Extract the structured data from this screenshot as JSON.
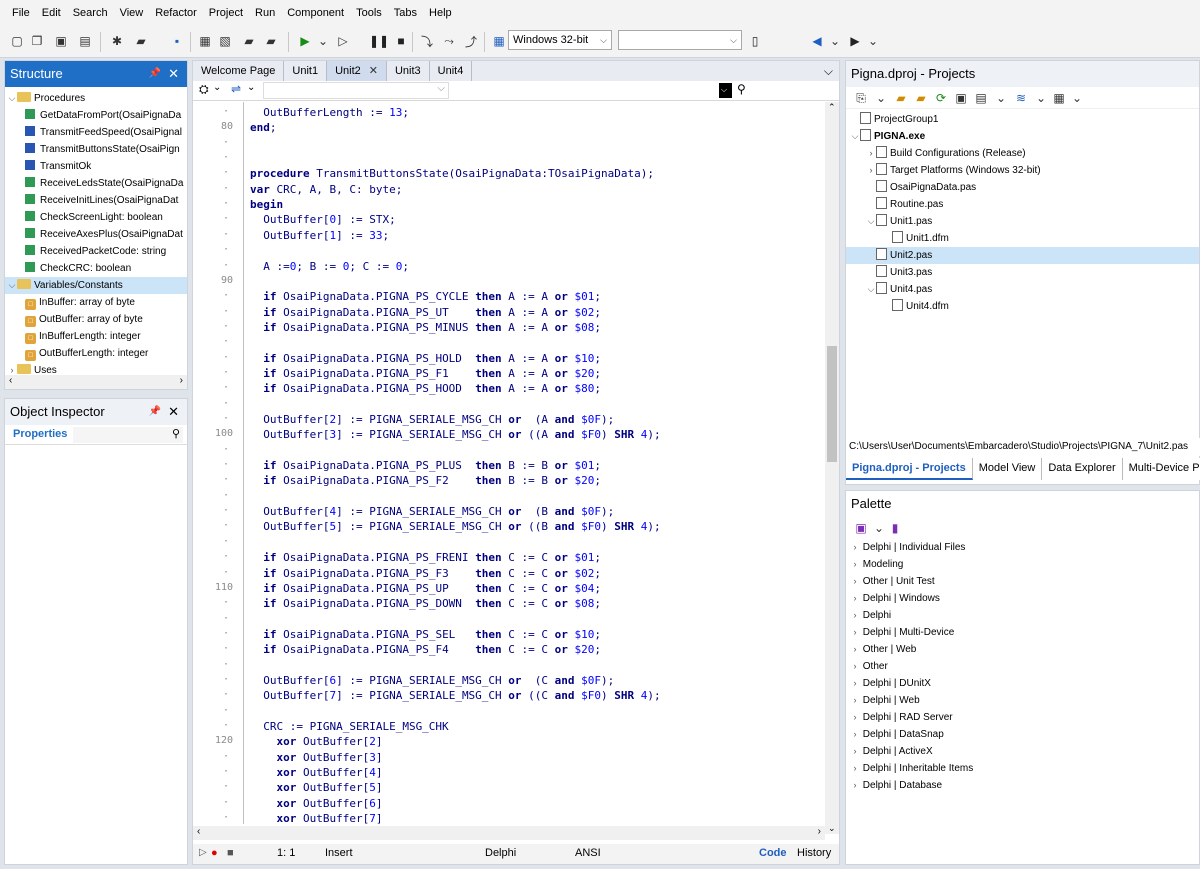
{
  "menu": [
    "File",
    "Edit",
    "Search",
    "View",
    "Refactor",
    "Project",
    "Run",
    "Component",
    "Tools",
    "Tabs",
    "Help"
  ],
  "toolbar": {
    "platform": "Windows 32-bit",
    "config": ""
  },
  "structure": {
    "title": "Structure",
    "items": [
      {
        "label": "Procedures",
        "kind": "folder",
        "level": 0,
        "expanded": true
      },
      {
        "label": "GetDataFromPort(OsaiPignaDa",
        "kind": "proc-green",
        "level": 1
      },
      {
        "label": "TransmitFeedSpeed(OsaiPignal",
        "kind": "proc-blue",
        "level": 1
      },
      {
        "label": "TransmitButtonsState(OsaiPign",
        "kind": "proc-blue",
        "level": 1
      },
      {
        "label": "TransmitOk",
        "kind": "proc-blue",
        "level": 1
      },
      {
        "label": "ReceiveLedsState(OsaiPignaDa",
        "kind": "proc-green",
        "level": 1
      },
      {
        "label": "ReceiveInitLines(OsaiPignaDat",
        "kind": "proc-green",
        "level": 1
      },
      {
        "label": "CheckScreenLight: boolean",
        "kind": "proc-green",
        "level": 1
      },
      {
        "label": "ReceiveAxesPlus(OsaiPignaDat",
        "kind": "proc-green",
        "level": 1
      },
      {
        "label": "ReceivedPacketCode: string",
        "kind": "proc-green",
        "level": 1
      },
      {
        "label": "CheckCRC: boolean",
        "kind": "proc-green",
        "level": 1
      },
      {
        "label": "Variables/Constants",
        "kind": "folder",
        "level": 0,
        "expanded": true,
        "selected": true
      },
      {
        "label": "InBuffer: array of byte",
        "kind": "var",
        "level": 1
      },
      {
        "label": "OutBuffer: array of byte",
        "kind": "var",
        "level": 1
      },
      {
        "label": "InBufferLength: integer",
        "kind": "var",
        "level": 1
      },
      {
        "label": "OutBufferLength: integer",
        "kind": "var",
        "level": 1
      },
      {
        "label": "Uses",
        "kind": "folder",
        "level": 0,
        "expanded": false
      }
    ]
  },
  "inspector": {
    "title": "Object Inspector",
    "tab": "Properties"
  },
  "editor": {
    "tabs": [
      "Welcome Page",
      "Unit1",
      "Unit2",
      "Unit3",
      "Unit4"
    ],
    "active_tab": "Unit2",
    "lines": [
      {
        "n": "",
        "t": "  OutBufferLength := 13;"
      },
      {
        "n": "80",
        "t": "end;"
      },
      {
        "n": "",
        "t": ""
      },
      {
        "n": "",
        "t": ""
      },
      {
        "n": "",
        "t": "procedure TransmitButtonsState(OsaiPignaData:TOsaiPignaData);"
      },
      {
        "n": "",
        "t": "var CRC, A, B, C: byte;"
      },
      {
        "n": "",
        "t": "begin"
      },
      {
        "n": "",
        "t": "  OutBuffer[0] := STX;"
      },
      {
        "n": "",
        "t": "  OutBuffer[1] := 33;"
      },
      {
        "n": "",
        "t": ""
      },
      {
        "n": "",
        "t": "  A :=0; B := 0; C := 0;"
      },
      {
        "n": "90",
        "t": ""
      },
      {
        "n": "",
        "t": "  if OsaiPignaData.PIGNA_PS_CYCLE then A := A or $01;"
      },
      {
        "n": "",
        "t": "  if OsaiPignaData.PIGNA_PS_UT    then A := A or $02;"
      },
      {
        "n": "",
        "t": "  if OsaiPignaData.PIGNA_PS_MINUS then A := A or $08;"
      },
      {
        "n": "",
        "t": ""
      },
      {
        "n": "",
        "t": "  if OsaiPignaData.PIGNA_PS_HOLD  then A := A or $10;"
      },
      {
        "n": "",
        "t": "  if OsaiPignaData.PIGNA_PS_F1    then A := A or $20;"
      },
      {
        "n": "",
        "t": "  if OsaiPignaData.PIGNA_PS_HOOD  then A := A or $80;"
      },
      {
        "n": "",
        "t": ""
      },
      {
        "n": "",
        "t": "  OutBuffer[2] := PIGNA_SERIALE_MSG_CH or  (A and $0F);"
      },
      {
        "n": "100",
        "t": "  OutBuffer[3] := PIGNA_SERIALE_MSG_CH or ((A and $F0) SHR 4);"
      },
      {
        "n": "",
        "t": ""
      },
      {
        "n": "",
        "t": "  if OsaiPignaData.PIGNA_PS_PLUS  then B := B or $01;"
      },
      {
        "n": "",
        "t": "  if OsaiPignaData.PIGNA_PS_F2    then B := B or $20;"
      },
      {
        "n": "",
        "t": ""
      },
      {
        "n": "",
        "t": "  OutBuffer[4] := PIGNA_SERIALE_MSG_CH or  (B and $0F);"
      },
      {
        "n": "",
        "t": "  OutBuffer[5] := PIGNA_SERIALE_MSG_CH or ((B and $F0) SHR 4);"
      },
      {
        "n": "",
        "t": ""
      },
      {
        "n": "",
        "t": "  if OsaiPignaData.PIGNA_PS_FRENI then C := C or $01;"
      },
      {
        "n": "",
        "t": "  if OsaiPignaData.PIGNA_PS_F3    then C := C or $02;"
      },
      {
        "n": "110",
        "t": "  if OsaiPignaData.PIGNA_PS_UP    then C := C or $04;"
      },
      {
        "n": "",
        "t": "  if OsaiPignaData.PIGNA_PS_DOWN  then C := C or $08;"
      },
      {
        "n": "",
        "t": ""
      },
      {
        "n": "",
        "t": "  if OsaiPignaData.PIGNA_PS_SEL   then C := C or $10;"
      },
      {
        "n": "",
        "t": "  if OsaiPignaData.PIGNA_PS_F4    then C := C or $20;"
      },
      {
        "n": "",
        "t": ""
      },
      {
        "n": "",
        "t": "  OutBuffer[6] := PIGNA_SERIALE_MSG_CH or  (C and $0F);"
      },
      {
        "n": "",
        "t": "  OutBuffer[7] := PIGNA_SERIALE_MSG_CH or ((C and $F0) SHR 4);"
      },
      {
        "n": "",
        "t": ""
      },
      {
        "n": "",
        "t": "  CRC := PIGNA_SERIALE_MSG_CHK"
      },
      {
        "n": "120",
        "t": "    xor OutBuffer[2]"
      },
      {
        "n": "",
        "t": "    xor OutBuffer[3]"
      },
      {
        "n": "",
        "t": "    xor OutBuffer[4]"
      },
      {
        "n": "",
        "t": "    xor OutBuffer[5]"
      },
      {
        "n": "",
        "t": "    xor OutBuffer[6]"
      },
      {
        "n": "",
        "t": "    xor OutBuffer[7]"
      }
    ],
    "status": {
      "position": "1:  1",
      "mode": "Insert",
      "language": "Delphi",
      "encoding": "ANSI",
      "code_tab": "Code",
      "history_tab": "History"
    }
  },
  "projects": {
    "title": "Pigna.dproj - Projects",
    "items": [
      {
        "label": "ProjectGroup1",
        "level": 0,
        "bold": false
      },
      {
        "label": "PIGNA.exe",
        "level": 0,
        "bold": true
      },
      {
        "label": "Build Configurations (Release)",
        "level": 1
      },
      {
        "label": "Target Platforms (Windows 32-bit)",
        "level": 1
      },
      {
        "label": "OsaiPignaData.pas",
        "level": 1
      },
      {
        "label": "Routine.pas",
        "level": 1
      },
      {
        "label": "Unit1.pas",
        "level": 1
      },
      {
        "label": "Unit1.dfm",
        "level": 2
      },
      {
        "label": "Unit2.pas",
        "level": 1,
        "selected": true
      },
      {
        "label": "Unit3.pas",
        "level": 1
      },
      {
        "label": "Unit4.pas",
        "level": 1
      },
      {
        "label": "Unit4.dfm",
        "level": 2
      }
    ],
    "path": "C:\\Users\\User\\Documents\\Embarcadero\\Studio\\Projects\\PIGNA_7\\Unit2.pas",
    "tabs": [
      "Pigna.dproj - Projects",
      "Model View",
      "Data Explorer",
      "Multi-Device Preview"
    ]
  },
  "palette": {
    "title": "Palette",
    "items": [
      "Delphi | Individual Files",
      "Modeling",
      "Other | Unit Test",
      "Delphi | Windows",
      "Delphi",
      "Delphi | Multi-Device",
      "Other | Web",
      "Other",
      "Delphi | DUnitX",
      "Delphi | Web",
      "Delphi | RAD Server",
      "Delphi | DataSnap",
      "Delphi | ActiveX",
      "Delphi | Inheritable Items",
      "Delphi | Database"
    ]
  },
  "colors": {
    "accent": "#1f6fc6",
    "keyword": "#000080",
    "number": "#0000ff",
    "selection": "#cce4f7"
  }
}
